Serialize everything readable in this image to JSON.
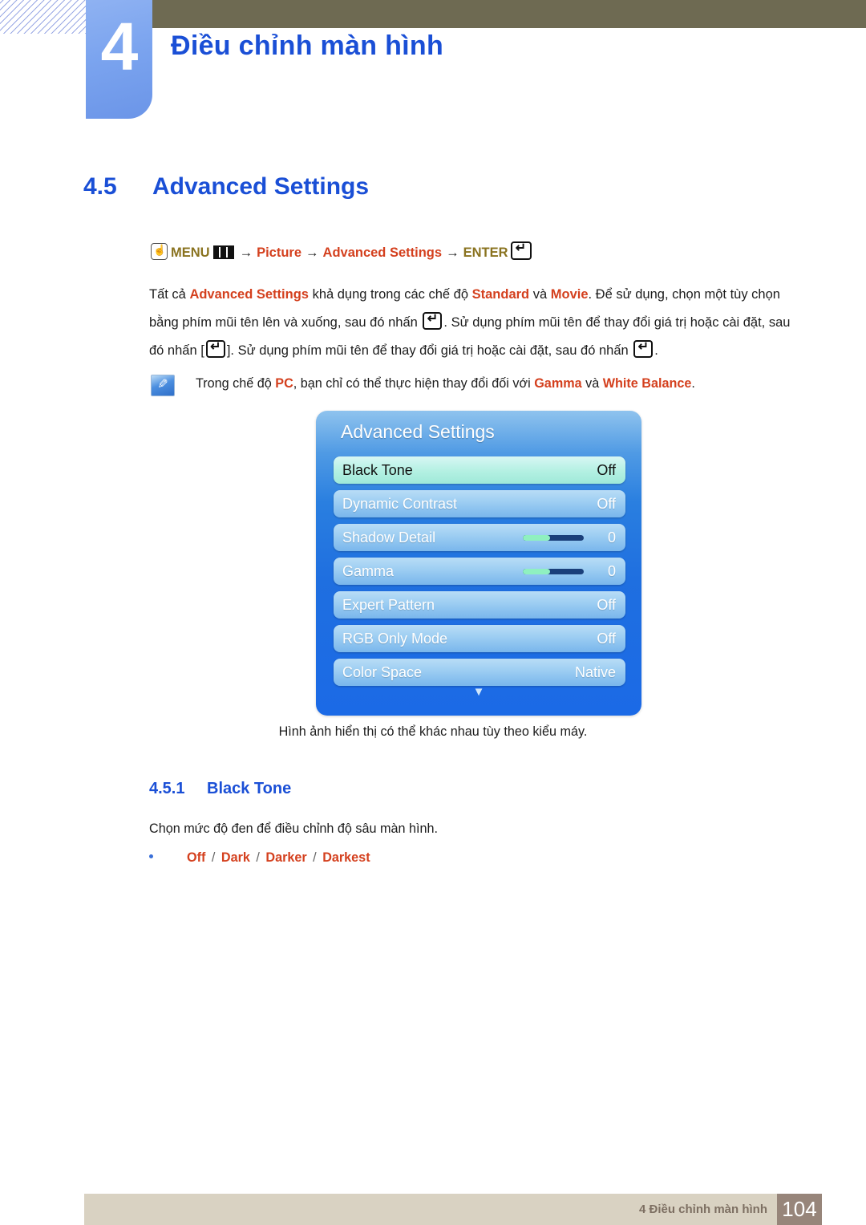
{
  "header": {
    "chapter_number": "4",
    "chapter_title": "Điều chỉnh màn hình"
  },
  "section": {
    "number": "4.5",
    "title": "Advanced Settings"
  },
  "menu_path": {
    "hand_icon": "hand-pointer-icon",
    "menu_label": "MENU",
    "menu_icon": "menu-bars-icon",
    "arrow": "→",
    "picture_label": "Picture",
    "advanced_label": "Advanced Settings",
    "enter_label": "ENTER",
    "enter_icon": "enter-key-icon"
  },
  "body": {
    "p1_a": "Tất cả ",
    "p1_b1": "Advanced Settings",
    "p1_c": " khả dụng trong các chế độ ",
    "p1_b2": "Standard",
    "p1_d": " và ",
    "p1_b3": "Movie",
    "p1_e": ". Để sử dụng, chọn một tùy chọn bằng phím mũi tên lên và xuống, sau đó nhấn ",
    "p1_f": ". Sử dụng phím mũi tên để thay đổi giá trị hoặc cài đặt, sau đó nhấn [",
    "p1_g": "]. Sử dụng phím mũi tên để thay đổi giá trị hoặc cài đặt, sau đó nhấn ",
    "p1_h": "."
  },
  "note": {
    "icon": "note-pen-icon",
    "a": "Trong chế độ ",
    "b1": "PC",
    "c": ", bạn chỉ có thể thực hiện thay đổi đối với ",
    "b2": "Gamma",
    "d": " và ",
    "b3": "White Balance",
    "e": "."
  },
  "osd": {
    "title": "Advanced Settings",
    "rows": [
      {
        "label": "Black Tone",
        "value": "Off",
        "selected": true,
        "slider": null
      },
      {
        "label": "Dynamic Contrast",
        "value": "Off",
        "selected": false,
        "slider": null
      },
      {
        "label": "Shadow Detail",
        "value": "0",
        "selected": false,
        "slider": 45
      },
      {
        "label": "Gamma",
        "value": "0",
        "selected": false,
        "slider": 45
      },
      {
        "label": "Expert Pattern",
        "value": "Off",
        "selected": false,
        "slider": null
      },
      {
        "label": "RGB Only Mode",
        "value": "Off",
        "selected": false,
        "slider": null
      },
      {
        "label": "Color Space",
        "value": "Native",
        "selected": false,
        "slider": null
      }
    ],
    "scroll_down_icon": "chevron-down-icon",
    "caption": "Hình ảnh hiển thị có thể khác nhau tùy theo kiểu máy."
  },
  "subsection": {
    "number": "4.5.1",
    "title": "Black Tone",
    "description": "Chọn mức độ đen để điều chỉnh độ sâu màn hình.",
    "options": [
      "Off",
      "Dark",
      "Darker",
      "Darkest"
    ],
    "option_separator": "/"
  },
  "footer": {
    "text": "4 Điều chỉnh màn hình",
    "page_number": "104"
  },
  "colors": {
    "accent_blue": "#1a4fd6",
    "accent_red": "#d4401e",
    "olive": "#6e6a52",
    "menu_olive": "#8a7320",
    "footer_band": "#d9d2c2",
    "footer_page_box": "#97857a",
    "osd_blue": "#1f6fe0",
    "osd_row": "#9ccdf2",
    "osd_selected": "#b3f0e2",
    "slider_fill": "#8ff0c0",
    "slider_track": "#1a3f7a"
  }
}
